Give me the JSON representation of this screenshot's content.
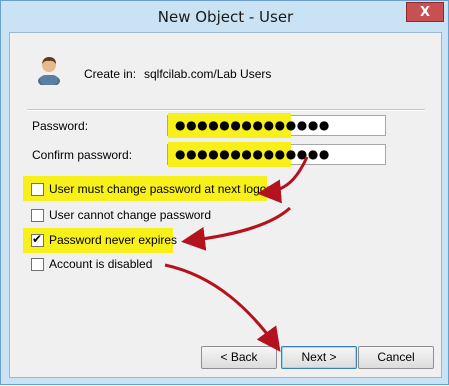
{
  "window": {
    "title": "New Object - User",
    "close_glyph": "X"
  },
  "create_in": {
    "label": "Create in:",
    "value": "sqlfcilab.com/Lab Users",
    "icon": "user-icon"
  },
  "password": {
    "label": "Password:",
    "value": "●●●●●●●●●●●●●●"
  },
  "confirm_password": {
    "label": "Confirm password:",
    "value": "●●●●●●●●●●●●●●"
  },
  "options": [
    {
      "label": "User must change password at next logon",
      "checked": false
    },
    {
      "label": "User cannot change password",
      "checked": false
    },
    {
      "label": "Password never expires",
      "checked": true
    },
    {
      "label": "Account is disabled",
      "checked": false
    }
  ],
  "buttons": {
    "back": "< Back",
    "next": "Next >",
    "cancel": "Cancel"
  },
  "colors": {
    "highlight": "#f8f01a",
    "arrow": "#b4121d",
    "title_bar": "#c9e3f4",
    "close": "#c75050"
  }
}
